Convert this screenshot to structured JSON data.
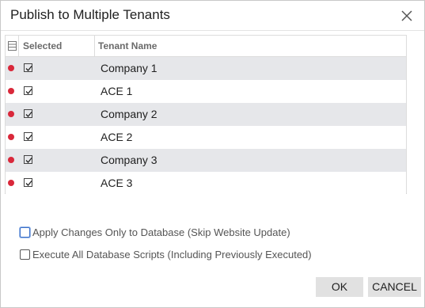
{
  "dialog": {
    "title": "Publish to Multiple Tenants",
    "close_icon": "close-icon"
  },
  "grid": {
    "header_icon": "column-config-icon",
    "columns": [
      "Selected",
      "Tenant Name"
    ],
    "rows": [
      {
        "name": "Company 1",
        "selected": true,
        "indicator_color": "#d9283a"
      },
      {
        "name": "ACE 1",
        "selected": true,
        "indicator_color": "#d9283a"
      },
      {
        "name": "Company 2",
        "selected": true,
        "indicator_color": "#d9283a"
      },
      {
        "name": "ACE 2",
        "selected": true,
        "indicator_color": "#d9283a"
      },
      {
        "name": "Company 3",
        "selected": true,
        "indicator_color": "#d9283a"
      },
      {
        "name": "ACE 3",
        "selected": true,
        "indicator_color": "#d9283a"
      }
    ]
  },
  "options": [
    {
      "label": "Apply Changes Only to Database (Skip Website Update)",
      "checked": false
    },
    {
      "label": "Execute All Database Scripts (Including Previously Executed)",
      "checked": false
    }
  ],
  "buttons": {
    "ok": "OK",
    "cancel": "CANCEL"
  }
}
